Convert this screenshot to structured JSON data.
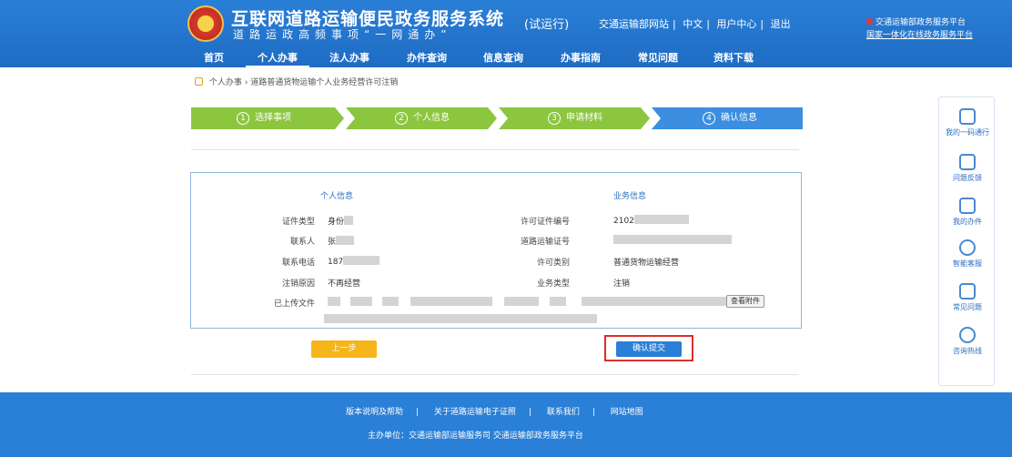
{
  "header": {
    "title": "互联网道路运输便民政务服务系统",
    "subtitle": "道路运政高频事项“一网通办”",
    "badge": "(试运行)",
    "links": [
      "交通运输部网站",
      "中文",
      "用户中心",
      "退出"
    ],
    "right_notice": "交通运输部政务服务平台",
    "right_link": "国家一体化在线政务服务平台"
  },
  "nav": [
    "首页",
    "个人办事",
    "法人办事",
    "办件查询",
    "信息查询",
    "办事指南",
    "常见问题",
    "资料下载"
  ],
  "breadcrumb": [
    "个人办事",
    "道路普通货物运输个人业务经营许可注销"
  ],
  "steps": [
    {
      "num": "1",
      "label": "选择事项",
      "state": "done"
    },
    {
      "num": "2",
      "label": "个人信息",
      "state": "done"
    },
    {
      "num": "3",
      "label": "申请材料",
      "state": "done"
    },
    {
      "num": "4",
      "label": "确认信息",
      "state": "current"
    }
  ],
  "panel": {
    "left_title": "个人信息",
    "right_title": "业务信息",
    "left_rows": [
      {
        "label": "证件类型",
        "value": "身份"
      },
      {
        "label": "联系人",
        "value": "张"
      },
      {
        "label": "联系电话",
        "value": "187"
      },
      {
        "label": "注销原因",
        "value": "不再经营"
      },
      {
        "label": "已上传文件",
        "value": ""
      }
    ],
    "right_rows": [
      {
        "label": "许可证件编号",
        "value": "2102"
      },
      {
        "label": "道路运输证号",
        "value": ""
      },
      {
        "label": "许可类别",
        "value": "普通货物运输经营"
      },
      {
        "label": "业务类型",
        "value": "注销"
      }
    ],
    "upload_label": "查看附件"
  },
  "buttons": {
    "prev": "上一步",
    "confirm": "确认提交"
  },
  "footer": {
    "links": [
      "版本说明及帮助",
      "关于道路运输电子证照",
      "联系我们",
      "网站地图"
    ],
    "host": "主办单位：交通运输部运输服务司   交通运输部政务服务平台"
  },
  "sidebar": [
    "我的一码通行",
    "问题反馈",
    "我的办件",
    "智能客服",
    "常见问题",
    "咨询热线"
  ],
  "colors": {
    "header_blue": "#2a7fd6",
    "step_done": "#8cc63f",
    "step_current": "#3b8ee0",
    "confirm_highlight": "#d9302a",
    "prev_button": "#f5b51b"
  }
}
